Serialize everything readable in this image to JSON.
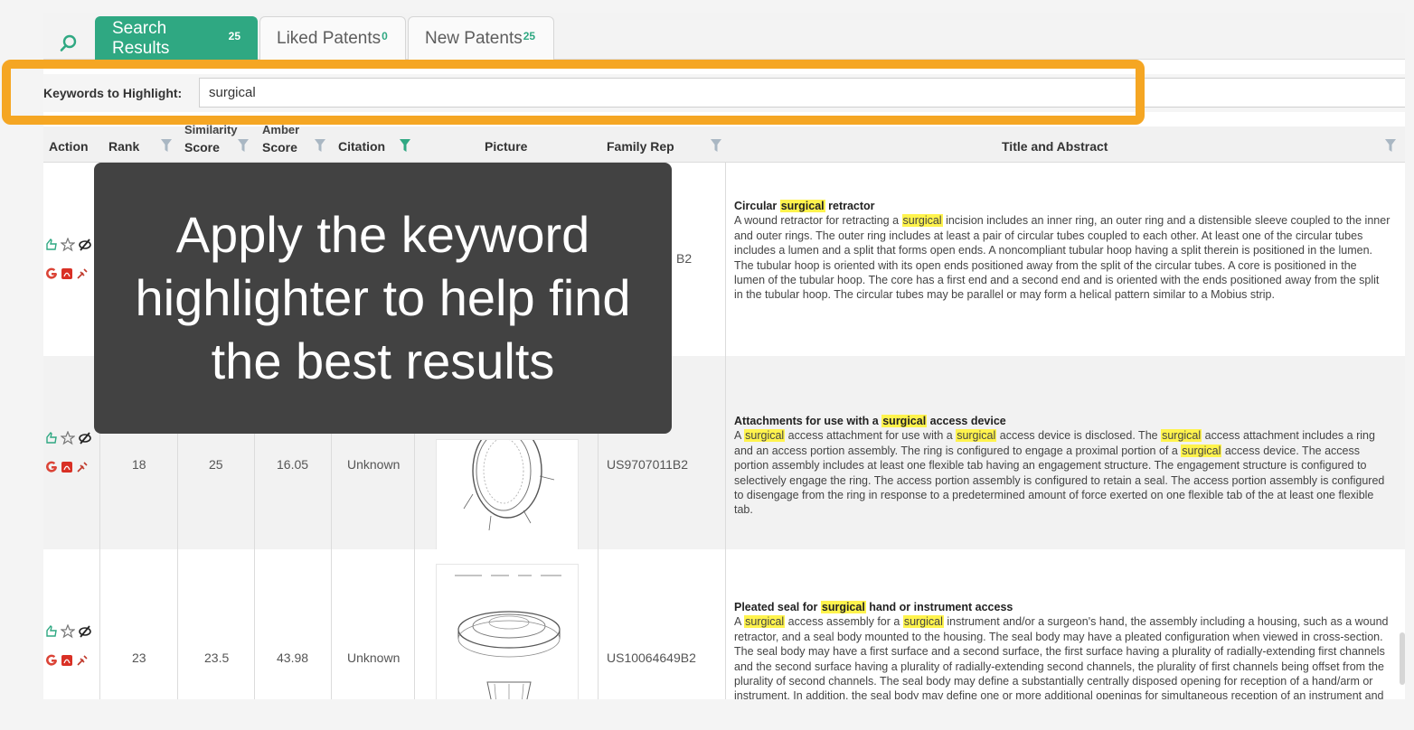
{
  "tabs": {
    "search_results": {
      "label": "Search Results",
      "count": "25"
    },
    "liked_patents": {
      "label": "Liked Patents",
      "count": "0"
    },
    "new_patents": {
      "label": "New Patents",
      "count": "25"
    }
  },
  "keywords": {
    "label": "Keywords to Highlight:",
    "value": "surgical"
  },
  "columns": {
    "action": "Action",
    "rank": "Rank",
    "similarity_top": "Similarity",
    "similarity_bottom": "Score",
    "amber_top": "Amber",
    "amber_bottom": "Score",
    "citation": "Citation",
    "picture": "Picture",
    "family_rep": "Family Rep",
    "title_abstract": "Title and Abstract"
  },
  "overlay": {
    "text": "Apply the keyword highlighter to help find the best results"
  },
  "rows": [
    {
      "rank": "",
      "similarity": "",
      "amber": "",
      "citation": "",
      "family_rep": "B2",
      "title_pre": "Circular ",
      "title_hl": "surgical",
      "title_post": " retractor",
      "abs_a": "A wound retractor for retracting a ",
      "abs_hl1": "surgical",
      "abs_b": " incision includes an inner ring, an outer ring and a distensible sleeve coupled to the inner and outer rings. The outer ring includes at least a pair of circular tubes coupled to each other. At least one of the circular tubes includes a lumen and a split that forms open ends. A noncompliant tubular hoop having a split therein is positioned in the lumen. The tubular hoop is oriented with its open ends positioned away from the split of the circular tubes. A core is positioned in the lumen of the tubular hoop. The core has a first end and a second end and is oriented with the ends positioned away from the split in the tubular hoop. The circular tubes may be parallel or may form a helical pattern similar to a Mobius strip."
    },
    {
      "rank": "18",
      "similarity": "25",
      "amber": "16.05",
      "citation": "Unknown",
      "family_rep": "US9707011B2",
      "title_pre": "Attachments for use with a ",
      "title_hl": "surgical",
      "title_post": " access device",
      "abs_hl0": "surgical",
      "abs_a": " access attachment for use with a ",
      "abs_hl1": "surgical",
      "abs_b": " access device is disclosed. The ",
      "abs_hl2": "surgical",
      "abs_c": " access attachment includes a ring and an access portion assembly. The ring is configured to engage a proximal portion of a ",
      "abs_hl3": "surgical",
      "abs_d": " access device. The access portion assembly includes at least one flexible tab having an engagement structure. The engagement structure is configured to selectively engage the ring. The access portion assembly is configured to retain a seal. The access portion assembly is configured to disengage from the ring in response to a predetermined amount of force exerted on one flexible tab of the at least one flexible tab."
    },
    {
      "rank": "23",
      "similarity": "23.5",
      "amber": "43.98",
      "citation": "Unknown",
      "family_rep": "US10064649B2",
      "title_pre": "Pleated seal for ",
      "title_hl": "surgical",
      "title_post": " hand or instrument access",
      "abs_hl0": "surgical",
      "abs_a": " access assembly for a ",
      "abs_hl1": "surgical",
      "abs_b": " instrument and/or a surgeon's hand, the assembly including a housing, such as a wound retractor, and a seal body mounted to the housing. The seal body may have a pleated configuration when viewed in cross-section. The seal body may have a first surface and a second surface, the first surface having a plurality of radially-extending first channels and the second surface having a plurality of radially-extending second channels, the plurality of first channels being offset from the plurality of second channels. The seal body may define a substantially centrally disposed opening for reception of a hand/arm or instrument. In addition, the seal body may define one or more additional openings for simultaneous reception of an instrument and a hand."
    }
  ],
  "colors": {
    "accent": "#2fa882",
    "highlight": "#fff34d",
    "frame": "#f5a623",
    "overlay": "#424242"
  }
}
